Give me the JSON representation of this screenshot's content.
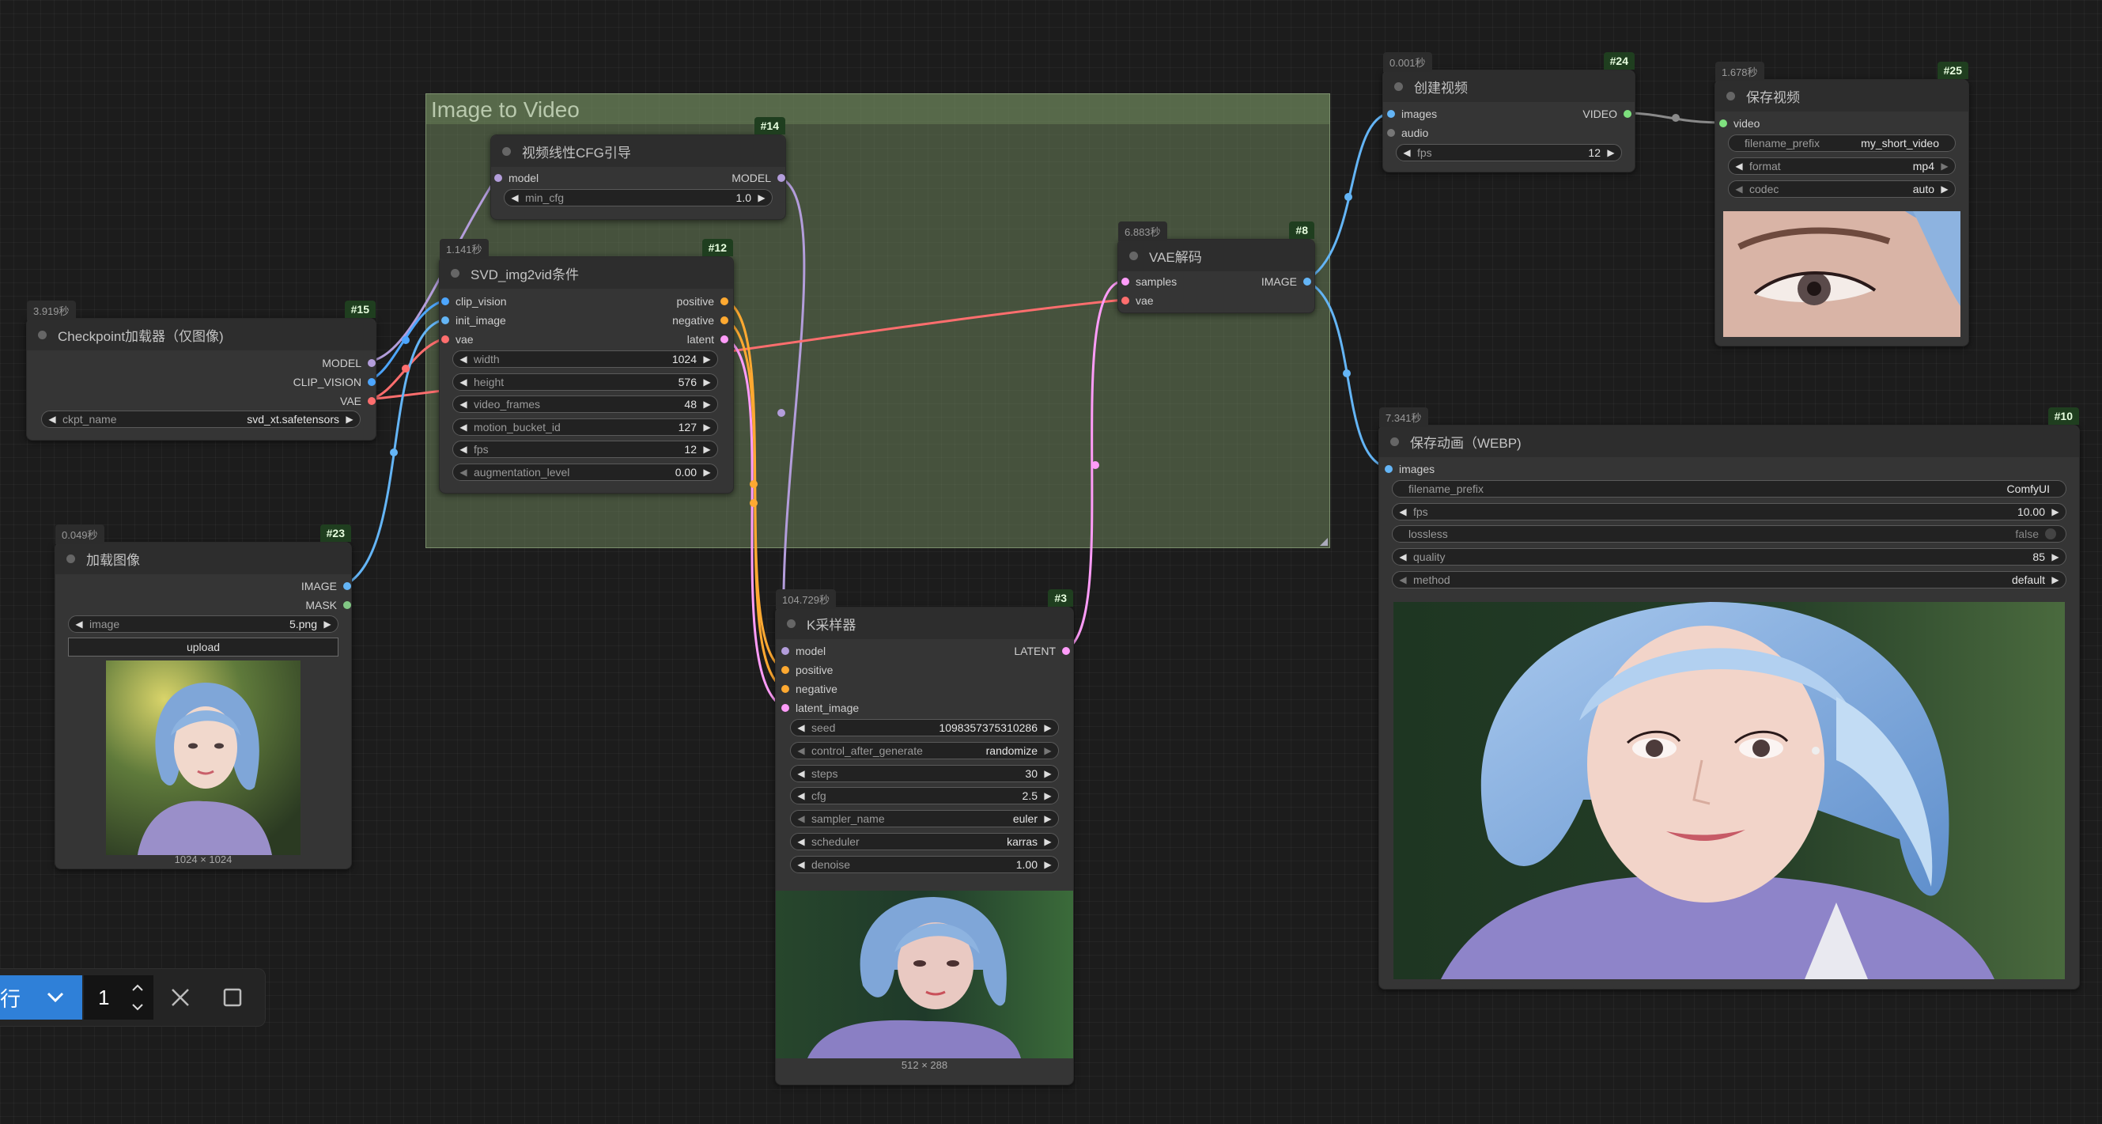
{
  "group": {
    "title": "Image to Video"
  },
  "colors": {
    "model": "#b39ddb",
    "clip_vision": "#4da6ff",
    "vae": "#ff6e6e",
    "image": "#64b5f6",
    "conditioning": "#ffa931",
    "latent": "#ff9cf9",
    "mask": "#81c784",
    "video": "#7ee07e",
    "group_bg": "#809e6c",
    "badge_bg": "#1f3e1f",
    "queue_blue": "#2f80d8"
  },
  "nodes": {
    "n15": {
      "time": "3.919秒",
      "id": "#15",
      "title": "Checkpoint加载器（仅图像)",
      "outputs": [
        "MODEL",
        "CLIP_VISION",
        "VAE"
      ],
      "widgets": {
        "ckpt_name": {
          "label": "ckpt_name",
          "value": "svd_xt.safetensors"
        }
      }
    },
    "n23": {
      "time": "0.049秒",
      "id": "#23",
      "title": "加载图像",
      "outputs": [
        "IMAGE",
        "MASK"
      ],
      "widgets": {
        "image": {
          "label": "image",
          "value": "5.png"
        }
      },
      "upload": "upload",
      "dims": "1024 × 1024"
    },
    "n14": {
      "id": "#14",
      "title": "视频线性CFG引导",
      "input": "model",
      "output": "MODEL",
      "widgets": {
        "min_cfg": {
          "label": "min_cfg",
          "value": "1.0"
        }
      }
    },
    "n12": {
      "time": "1.141秒",
      "id": "#12",
      "title": "SVD_img2vid条件",
      "inputs": [
        "clip_vision",
        "init_image",
        "vae"
      ],
      "outputs": [
        "positive",
        "negative",
        "latent"
      ],
      "widgets": [
        {
          "label": "width",
          "value": "1024"
        },
        {
          "label": "height",
          "value": "576"
        },
        {
          "label": "video_frames",
          "value": "48"
        },
        {
          "label": "motion_bucket_id",
          "value": "127"
        },
        {
          "label": "fps",
          "value": "12"
        },
        {
          "label": "augmentation_level",
          "value": "0.00"
        }
      ]
    },
    "n8": {
      "time": "6.883秒",
      "id": "#8",
      "title": "VAE解码",
      "inputs": [
        "samples",
        "vae"
      ],
      "output": "IMAGE"
    },
    "n3": {
      "time": "104.729秒",
      "id": "#3",
      "title": "K采样器",
      "inputs": [
        "model",
        "positive",
        "negative",
        "latent_image"
      ],
      "output": "LATENT",
      "widgets": [
        {
          "label": "seed",
          "value": "1098357375310286"
        },
        {
          "label": "control_after_generate",
          "value": "randomize"
        },
        {
          "label": "steps",
          "value": "30"
        },
        {
          "label": "cfg",
          "value": "2.5"
        },
        {
          "label": "sampler_name",
          "value": "euler"
        },
        {
          "label": "scheduler",
          "value": "karras"
        },
        {
          "label": "denoise",
          "value": "1.00"
        }
      ],
      "dims": "512 × 288"
    },
    "n24": {
      "time": "0.001秒",
      "id": "#24",
      "title": "创建视频",
      "inputs": [
        "images",
        "audio"
      ],
      "output": "VIDEO",
      "widgets": {
        "fps": {
          "label": "fps",
          "value": "12"
        }
      }
    },
    "n25": {
      "time": "1.678秒",
      "id": "#25",
      "title": "保存视频",
      "input": "video",
      "widgets": [
        {
          "label": "filename_prefix",
          "value": "my_short_video"
        },
        {
          "label": "format",
          "value": "mp4"
        },
        {
          "label": "codec",
          "value": "auto"
        }
      ]
    },
    "n10": {
      "time": "7.341秒",
      "id": "#10",
      "title": "保存动画（WEBP)",
      "input": "images",
      "widgets": [
        {
          "label": "filename_prefix",
          "value": "ComfyUI"
        },
        {
          "label": "fps",
          "value": "10.00"
        },
        {
          "label": "lossless",
          "value": "false"
        },
        {
          "label": "quality",
          "value": "85"
        },
        {
          "label": "method",
          "value": "default"
        }
      ]
    }
  },
  "queue": {
    "run_label": "行",
    "batch_count": "1"
  }
}
